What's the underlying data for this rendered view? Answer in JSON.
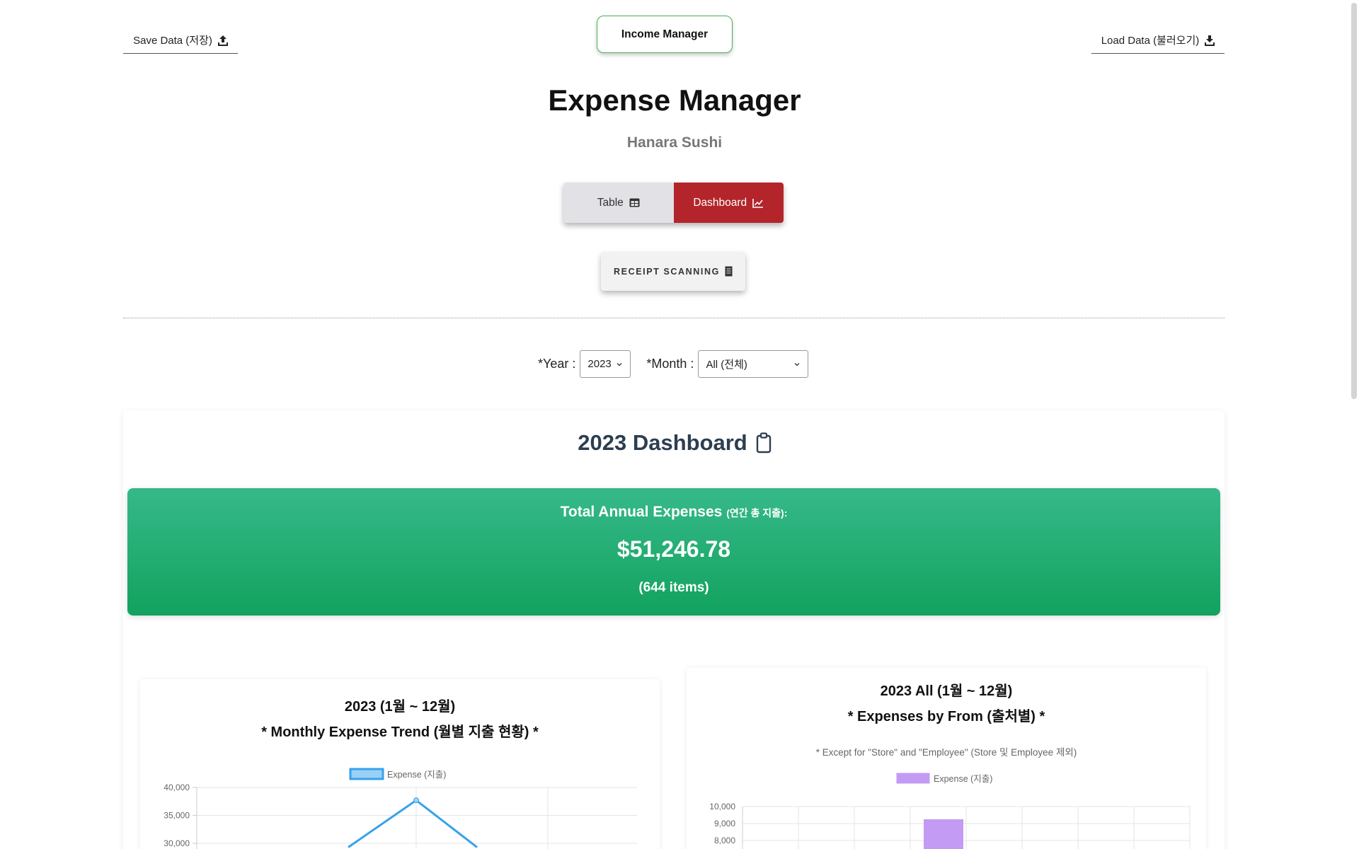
{
  "header": {
    "save_label": "Save Data (저장)",
    "income_label": "Income Manager",
    "load_label": "Load Data (불러오기)"
  },
  "title": "Expense Manager",
  "business_name": "Hanara Sushi",
  "view_toggle": {
    "table_label": "Table",
    "dashboard_label": "Dashboard",
    "active": "dashboard"
  },
  "receipt_label": "RECEIPT SCANNING",
  "filters": {
    "year_label": "*Year :",
    "year_value": "2023",
    "month_label": "*Month :",
    "month_value": "All (전체)"
  },
  "dashboard": {
    "title": "2023 Dashboard",
    "total_label": "Total Annual Expenses",
    "total_label_kr": "(연간 총 지출):",
    "total_amount": "$51,246.78",
    "total_count": "(644 items)"
  },
  "colors": {
    "accent_red": "#b3252b",
    "total_green": "#12a25e",
    "line_blue": "#36a2eb",
    "bar_purple": "#c39bf5"
  },
  "chart_data": [
    {
      "type": "line",
      "title": "2023 (1월 ~ 12월)",
      "subtitle": "* Monthly Expense Trend (월별 지출 현황) *",
      "legend": "Expense (지출)",
      "legend_position": "top",
      "y_ticks": [
        "40,000",
        "35,000",
        "30,000"
      ],
      "ylim_visible": [
        30000,
        40000
      ],
      "grid": true,
      "points_visible": [
        {
          "x": 1,
          "y": 29300
        },
        {
          "x": 2,
          "y": 37700
        },
        {
          "x": 3,
          "y": 29300
        }
      ]
    },
    {
      "type": "bar",
      "title": "2023 All (1월 ~ 12월)",
      "subtitle": "* Expenses by From (출처별) *",
      "note": "* Except for \"Store\" and \"Employee\" (Store 및 Employee 제외)",
      "legend": "Expense (지출)",
      "legend_position": "top",
      "y_ticks": [
        "10,000",
        "9,000",
        "8,000"
      ],
      "ylim_visible": [
        8000,
        10000
      ],
      "grid": true,
      "bars_visible": [
        {
          "index": 3,
          "value": 9250
        }
      ]
    }
  ]
}
